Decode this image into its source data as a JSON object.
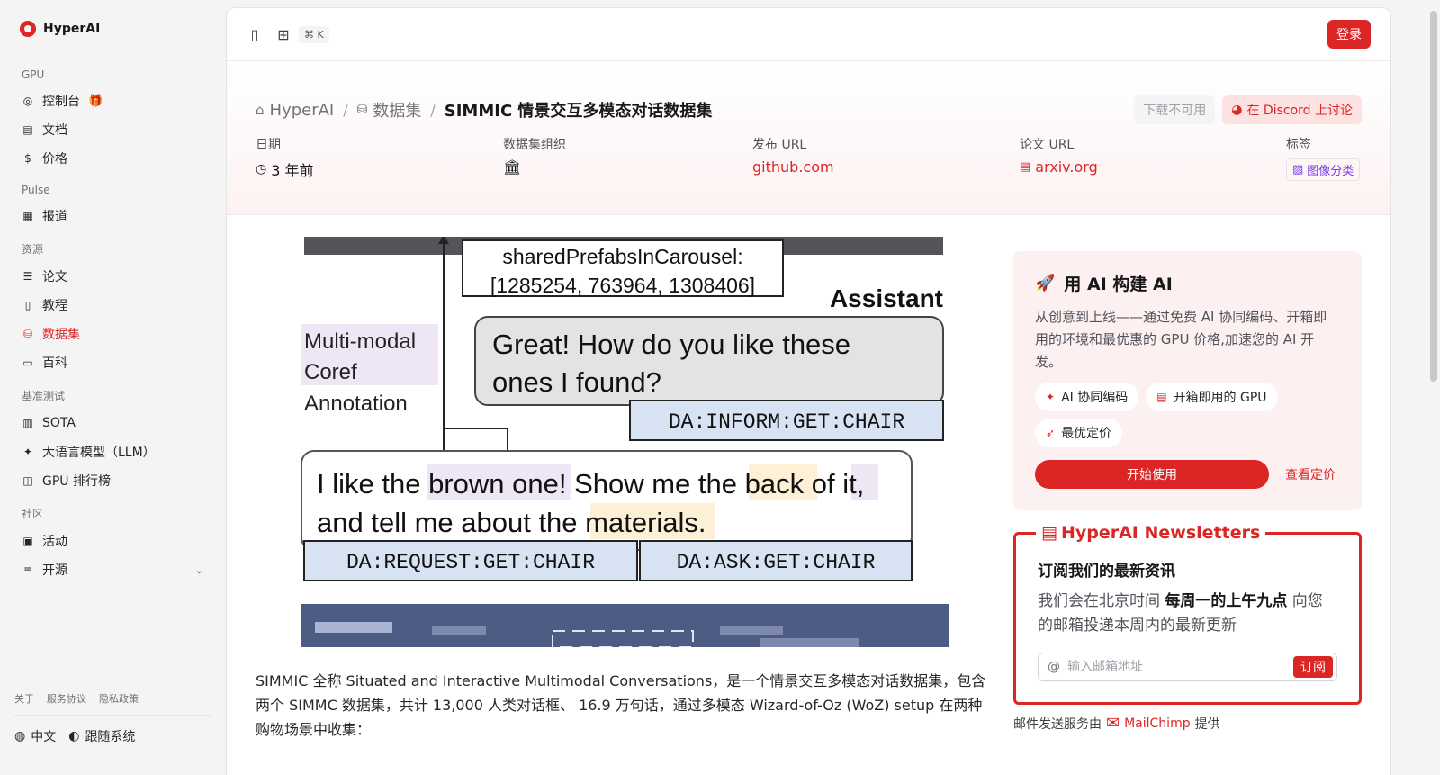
{
  "brand": {
    "name": "HyperAI"
  },
  "sidebar": {
    "sections": [
      {
        "title": "GPU",
        "items": [
          {
            "label": "控制台",
            "icon": "dashboard-icon"
          },
          {
            "label": "文档",
            "icon": "doc-icon"
          },
          {
            "label": "价格",
            "icon": "dollar-icon"
          }
        ]
      },
      {
        "title": "Pulse",
        "items": [
          {
            "label": "报道",
            "icon": "news-icon"
          }
        ]
      },
      {
        "title": "资源",
        "items": [
          {
            "label": "论文",
            "icon": "paper-icon"
          },
          {
            "label": "教程",
            "icon": "tutorial-icon"
          },
          {
            "label": "数据集",
            "icon": "database-icon"
          },
          {
            "label": "百科",
            "icon": "wiki-icon"
          }
        ]
      },
      {
        "title": "基准测试",
        "items": [
          {
            "label": "SOTA",
            "icon": "chart-icon"
          },
          {
            "label": "大语言模型（LLM）",
            "icon": "sparkle-icon"
          },
          {
            "label": "GPU 排行榜",
            "icon": "chip-icon"
          }
        ]
      },
      {
        "title": "社区",
        "items": [
          {
            "label": "活动",
            "icon": "calendar-icon"
          },
          {
            "label": "开源",
            "icon": "list-icon"
          }
        ]
      }
    ],
    "footer_links": [
      "关于",
      "服务协议",
      "隐私政策"
    ],
    "language": "中文",
    "theme": "跟随系统"
  },
  "topbar": {
    "shortcut": "⌘ K",
    "login_label": "登录"
  },
  "breadcrumb": {
    "home": "HyperAI",
    "section": "数据集",
    "current": "SIMMIC 情景交互多模态对话数据集"
  },
  "header_buttons": {
    "download": "下载不可用",
    "discord": "在 Discord 上讨论"
  },
  "meta": {
    "date_label": "日期",
    "date_value": "3 年前",
    "org_label": "数据集组织",
    "release_label": "发布 URL",
    "release_value": "github.com",
    "paper_label": "论文 URL",
    "paper_value": "arxiv.org",
    "tags_label": "标签",
    "tag_value": "图像分类"
  },
  "figure": {
    "carousel_text_1": "sharedPrefabsInCarousel:",
    "carousel_text_2": "[1285254, 763964, 1308406]",
    "assistant_label": "Assistant",
    "coref_1": "Multi-modal",
    "coref_2": "Coref",
    "coref_3": "Annotation",
    "assistant_text_1": "Great! How do you like these",
    "assistant_text_2": "ones I found?",
    "da_inform": "DA:INFORM:GET:CHAIR",
    "user_text_1a": "I like the ",
    "user_text_1b": "brown one",
    "user_text_1c": "! Show me the ",
    "user_text_1d": "back",
    "user_text_1e": " of ",
    "user_text_1f": "it",
    "user_text_1g": ",",
    "user_text_2a": "and tell me about the ",
    "user_text_2b": "materials",
    "user_text_2c": ".",
    "da_request": "DA:REQUEST:GET:CHAIR",
    "da_ask": "DA:ASK:GET:CHAIR"
  },
  "description": "SIMMIC 全称 Situated and Interactive Multimodal Conversations，是一个情景交互多模态对话数据集，包含两个 SIMMC 数据集，共计 13,000 人类对话框、 16.9 万句话，通过多模态 Wizard-of-Oz (WoZ) setup 在两种购物场景中收集：",
  "promo": {
    "title": "用 AI 构建 AI",
    "text": "从创意到上线——通过免费 AI 协同编码、开箱即用的环境和最优惠的 GPU 价格,加速您的 AI 开发。",
    "chips": [
      "AI 协同编码",
      "开箱即用的 GPU",
      "最优定价"
    ],
    "start_label": "开始使用",
    "pricing_label": "查看定价"
  },
  "newsletter": {
    "legend": "HyperAI Newsletters",
    "title": "订阅我们的最新资讯",
    "text_pre": "我们会在北京时间 ",
    "text_bold": "每周一的上午九点",
    "text_post": " 向您的邮箱投递本周内的最新更新",
    "placeholder": "输入邮箱地址",
    "subscribe_label": "订阅",
    "footer_pre": "邮件发送服务由",
    "footer_link": "MailChimp",
    "footer_post": "提供"
  },
  "colors": {
    "accent": "#dc2626"
  }
}
